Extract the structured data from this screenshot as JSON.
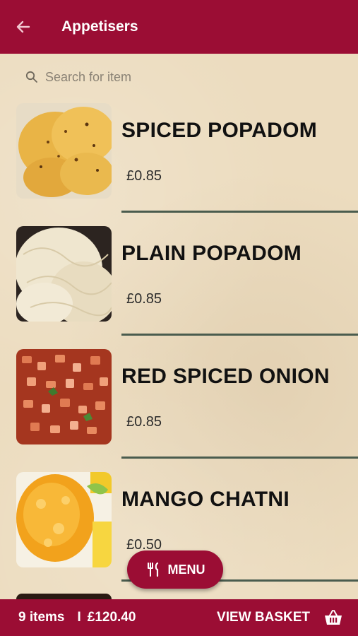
{
  "header": {
    "title": "Appetisers",
    "back_icon": "arrow-left-icon"
  },
  "search": {
    "placeholder": "Search for item",
    "value": "",
    "icon": "search-icon"
  },
  "items": [
    {
      "name": "SPICED POPADOM",
      "price": "£0.85",
      "image": "spiced-popadom-photo"
    },
    {
      "name": "PLAIN POPADOM",
      "price": "£0.85",
      "image": "plain-popadom-photo"
    },
    {
      "name": "RED SPICED ONION",
      "price": "£0.85",
      "image": "red-spiced-onion-photo"
    },
    {
      "name": "MANGO CHATNI",
      "price": "£0.50",
      "image": "mango-chatni-photo"
    }
  ],
  "menu_button": {
    "label": "MENU",
    "icon": "fork-knife-icon"
  },
  "basket_bar": {
    "count": "9 items",
    "separator": "I",
    "total": "£120.40",
    "view_label": "VIEW BASKET",
    "icon": "basket-icon"
  },
  "colors": {
    "brand": "#9b0d34",
    "background": "#ecdcbf",
    "divider": "#4a5c4e"
  }
}
